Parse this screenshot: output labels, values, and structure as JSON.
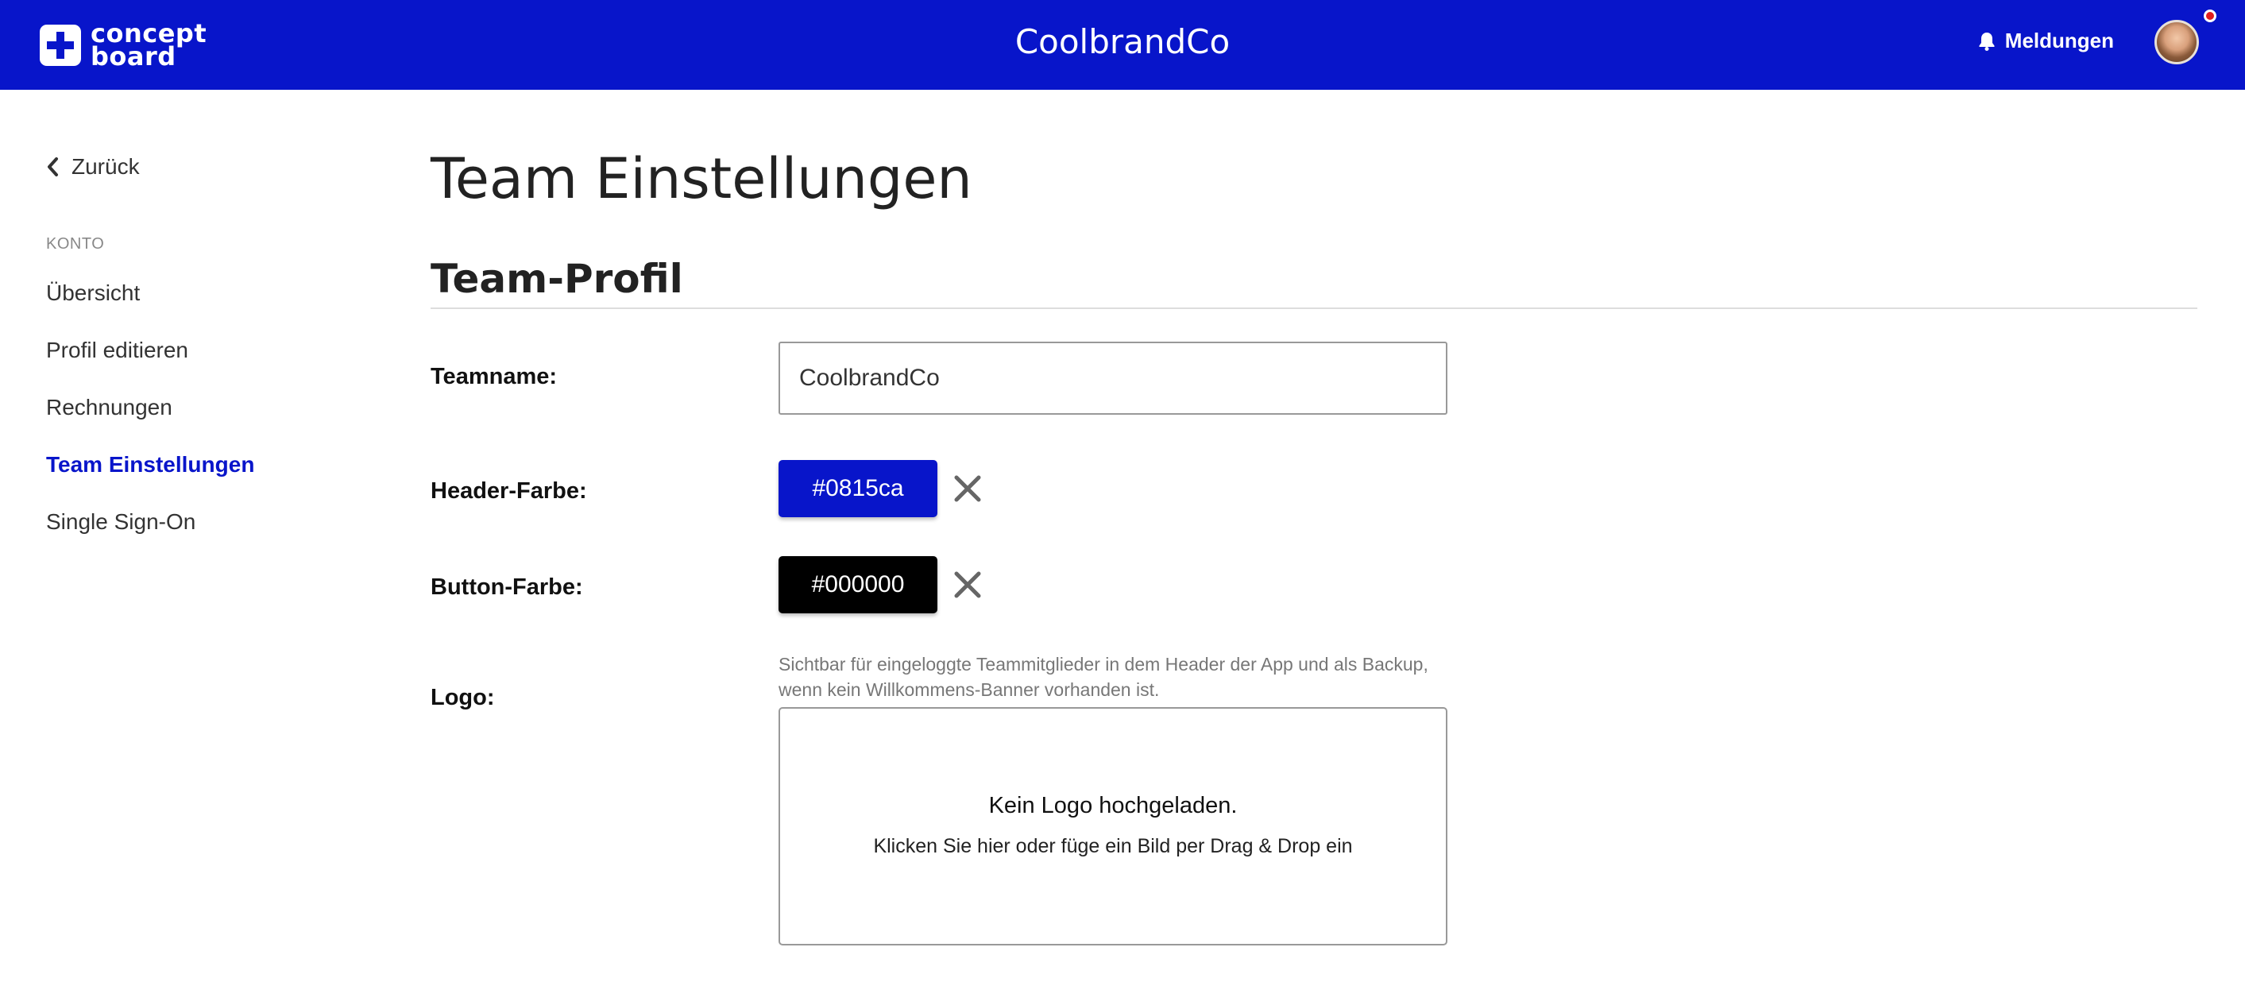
{
  "header": {
    "logo_line1": "concept",
    "logo_line2": "board",
    "title": "CoolbrandCo",
    "notifications_label": "Meldungen",
    "background_color": "#0815ca"
  },
  "sidebar": {
    "back_label": "Zurück",
    "section_label": "KONTO",
    "items": [
      {
        "label": "Übersicht",
        "active": false
      },
      {
        "label": "Profil editieren",
        "active": false
      },
      {
        "label": "Rechnungen",
        "active": false
      },
      {
        "label": "Team Einstellungen",
        "active": true
      },
      {
        "label": "Single Sign-On",
        "active": false
      }
    ]
  },
  "main": {
    "page_title": "Team Einstellungen",
    "section_title": "Team-Profil",
    "teamname": {
      "label": "Teamname:",
      "value": "CoolbrandCo"
    },
    "header_color": {
      "label": "Header-Farbe:",
      "value": "#0815ca"
    },
    "button_color": {
      "label": "Button-Farbe:",
      "value": "#000000"
    },
    "logo": {
      "label": "Logo:",
      "hint_line1": "Sichtbar für eingeloggte Teammitglieder in dem Header der App und als Backup,",
      "hint_line2": "wenn kein Willkommens-Banner vorhanden ist.",
      "dropzone_title": "Kein Logo hochgeladen.",
      "dropzone_subtitle": "Klicken Sie hier oder füge ein Bild per Drag & Drop ein"
    }
  },
  "icons": {
    "logo_mark": "plus-icon",
    "notifications": "bell-icon",
    "back": "chevron-left-icon",
    "clear": "close-icon"
  },
  "colors": {
    "accent": "#0815ca",
    "notification_dot": "#e11d1d"
  }
}
